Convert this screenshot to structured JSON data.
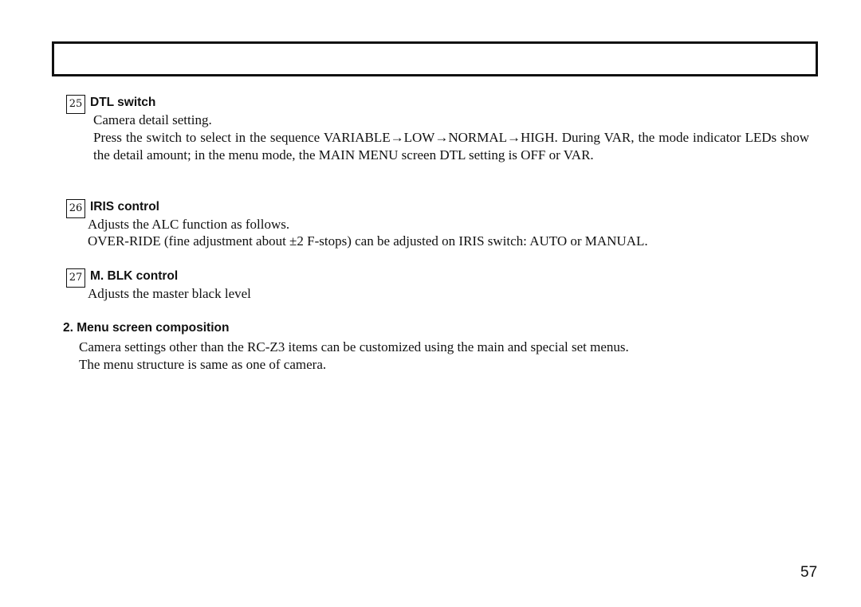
{
  "header": {
    "title": ""
  },
  "sections": [
    {
      "number": "25",
      "title": "DTL switch",
      "lines": [
        "Camera detail setting.",
        "Press the switch to select in the sequence VARIABLE→LOW→NORMAL→HIGH.  During VAR, the mode indicator LEDs show the detail amount; in the menu mode, the MAIN MENU screen DTL setting is OFF or VAR."
      ]
    },
    {
      "number": "26",
      "title": "IRIS control",
      "lines": [
        "Adjusts the ALC function as follows.",
        "OVER-RIDE (fine adjustment about  ±2 F-stops) can be adjusted on IRIS switch: AUTO or MANUAL."
      ]
    },
    {
      "number": "27",
      "title": "M. BLK control",
      "lines": [
        "Adjusts the master black level"
      ]
    }
  ],
  "menu_section": {
    "title": "2. Menu screen composition",
    "lines": [
      "Camera settings other than the RC-Z3 items can be customized using the main and special set menus.",
      "The menu structure is same as one of camera."
    ]
  },
  "page_number": "57"
}
